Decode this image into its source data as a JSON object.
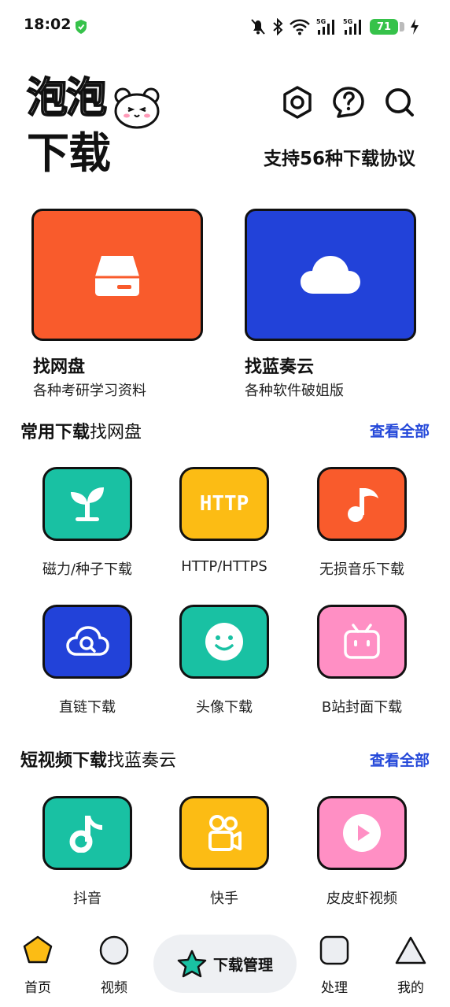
{
  "status_bar": {
    "time": "18:02",
    "battery": "71",
    "net1": "5G",
    "net2": "5G"
  },
  "header": {
    "logo_line1": "泡泡",
    "logo_line2": "下载",
    "protocol_text": "支持56种下载协议"
  },
  "featured": [
    {
      "title": "找网盘",
      "subtitle": "各种考研学习资料",
      "color": "#f95b2c",
      "icon": "drive-icon"
    },
    {
      "title": "找蓝奏云",
      "subtitle": "各种软件破姐版",
      "color": "#2242d9",
      "icon": "cloud-icon"
    }
  ],
  "section_common": {
    "title_bold": "常用下载",
    "title_rest": "找网盘",
    "more": "查看全部"
  },
  "common_items": [
    {
      "label": "磁力/种子下载",
      "color": "#19c1a3",
      "icon": "sprout-icon"
    },
    {
      "label": "HTTP/HTTPS",
      "color": "#fcbc14",
      "icon": "http-icon",
      "icon_text": "HTTP"
    },
    {
      "label": "无损音乐下载",
      "color": "#f95b2c",
      "icon": "music-note-icon"
    },
    {
      "label": "直链下载",
      "color": "#2242d9",
      "icon": "cloud-search-icon"
    },
    {
      "label": "头像下载",
      "color": "#19c1a3",
      "icon": "smiley-icon"
    },
    {
      "label": "B站封面下载",
      "color": "#ff8fc4",
      "icon": "tv-icon"
    }
  ],
  "section_video": {
    "title_bold": "短视频下载",
    "title_rest": "找蓝奏云",
    "more": "查看全部"
  },
  "video_items": [
    {
      "label": "抖音",
      "color": "#19c1a3",
      "icon": "tiktok-icon"
    },
    {
      "label": "快手",
      "color": "#fcbc14",
      "icon": "kuaishou-icon"
    },
    {
      "label": "皮皮虾视频",
      "color": "#ff8fc4",
      "icon": "play-icon"
    }
  ],
  "bottom_nav": {
    "home": "首页",
    "video": "视频",
    "downloads": "下载管理",
    "process": "处理",
    "mine": "我的"
  }
}
